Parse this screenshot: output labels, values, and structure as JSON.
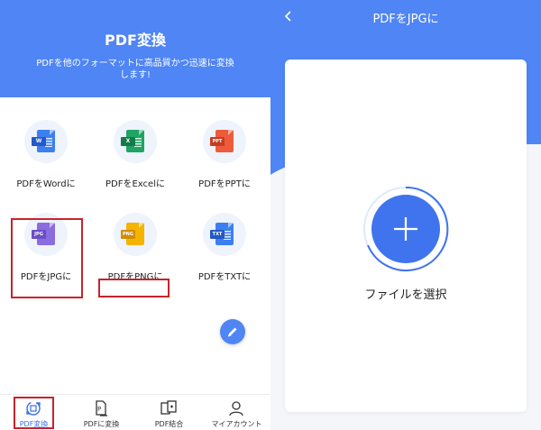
{
  "left_screen": {
    "header": {
      "title": "PDF変換",
      "subtitle": "PDFを他のフォーマットに高品質かつ迅速に変換します!"
    },
    "tools": [
      {
        "label": "PDFをWordに",
        "icon": "word-doc-icon",
        "badge": "W",
        "color": "#3c7ff2"
      },
      {
        "label": "PDFをExcelに",
        "icon": "excel-doc-icon",
        "badge": "X",
        "color": "#1fa463"
      },
      {
        "label": "PDFをPPTに",
        "icon": "ppt-doc-icon",
        "badge": "PPT",
        "color": "#ee5b3c"
      },
      {
        "label": "PDFをJPGに",
        "icon": "jpg-doc-icon",
        "badge": "JPG",
        "color": "#8a6ce0"
      },
      {
        "label": "PDFをPNGに",
        "icon": "png-doc-icon",
        "badge": "PNG",
        "color": "#f4b400"
      },
      {
        "label": "PDFをTXTに",
        "icon": "txt-doc-icon",
        "badge": "TXT",
        "color": "#3c7ff2"
      }
    ],
    "bottom_nav": [
      {
        "label": "PDF変換",
        "icon": "convert-icon",
        "active": true
      },
      {
        "label": "PDFに変換",
        "icon": "to-pdf-icon",
        "active": false
      },
      {
        "label": "PDF結合",
        "icon": "merge-icon",
        "active": false
      },
      {
        "label": "マイアカウント",
        "icon": "account-icon",
        "active": false
      }
    ],
    "fab_icon": "edit-pencil-icon"
  },
  "right_screen": {
    "header": {
      "title": "PDFをJPGに",
      "back_icon": "chevron-left-icon"
    },
    "select_button_icon": "plus-icon",
    "select_label": "ファイルを選択"
  },
  "colors": {
    "brand_blue": "#4f85f5",
    "button_blue": "#3f74ee",
    "highlight_red": "#c8232c"
  }
}
